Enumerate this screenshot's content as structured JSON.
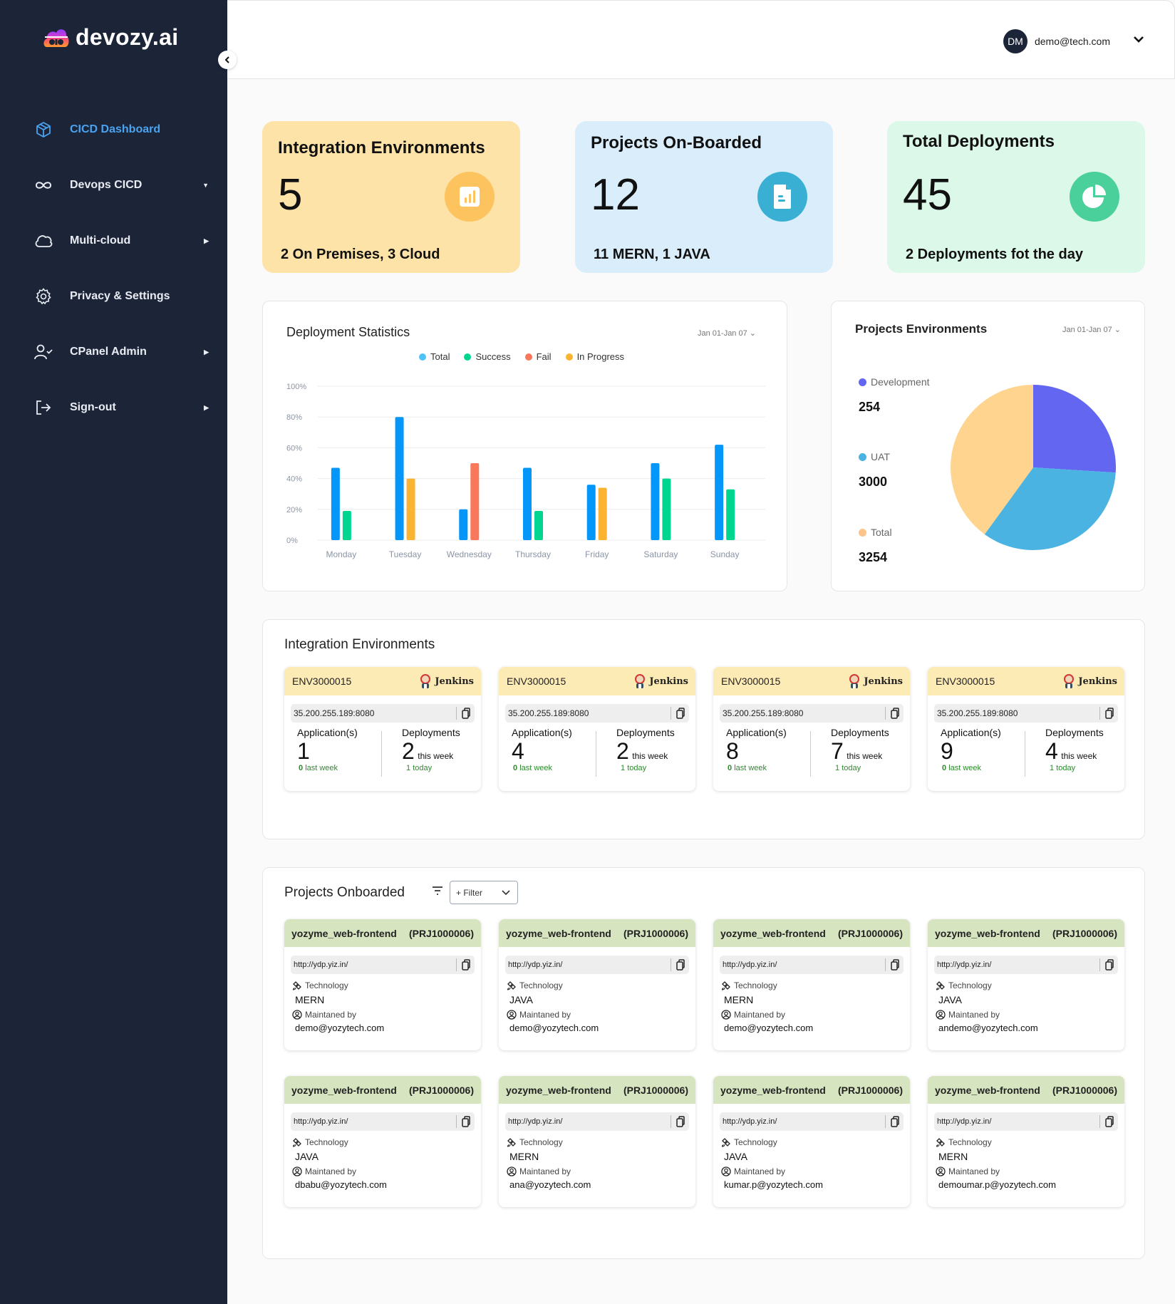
{
  "brand": {
    "name": "devozy.ai"
  },
  "sidebar": {
    "items": [
      {
        "label": "CICD Dashboard",
        "icon": "cube-icon",
        "active": true,
        "caret": ""
      },
      {
        "label": "Devops CICD",
        "icon": "infinity-icon",
        "active": false,
        "caret": "▼"
      },
      {
        "label": "Multi-cloud",
        "icon": "cloud-icon",
        "active": false,
        "caret": "▶"
      },
      {
        "label": "Privacy & Settings",
        "icon": "gear-icon",
        "active": false,
        "caret": ""
      },
      {
        "label": "CPanel Admin",
        "icon": "user-check-icon",
        "active": false,
        "caret": "▶"
      },
      {
        "label": "Sign-out",
        "icon": "sign-out-icon",
        "active": false,
        "caret": "▶"
      }
    ]
  },
  "header": {
    "user_initials": "DM",
    "user_email": "demo@tech.com"
  },
  "stats": [
    {
      "title": "Integration Environments",
      "value": "5",
      "subtitle": "2 On Premises, 3 Cloud",
      "bg": "#fee3a8",
      "icon_bg": "#fdc35e",
      "icon": "bar-chart-icon"
    },
    {
      "title": "Projects On-Boarded",
      "value": "12",
      "subtitle": "11 MERN, 1 JAVA",
      "bg": "#d9edfb",
      "icon_bg": "#3aafd4",
      "icon": "document-icon"
    },
    {
      "title": "Total Deployments",
      "value": "45",
      "subtitle": "2 Deployments fot the day",
      "bg": "#dcf8e8",
      "icon_bg": "#4ad09b",
      "icon": "pie-chart-icon"
    }
  ],
  "deployment_stats": {
    "title": "Deployment Statistics",
    "date_range": "Jan 01-Jan 07 ⌄"
  },
  "projects_environments": {
    "title": "Projects Environments",
    "date_range": "Jan 01-Jan 07 ⌄",
    "legend": [
      {
        "label": "Development",
        "value": "254",
        "color": "#6366f1"
      },
      {
        "label": "UAT",
        "value": "3000",
        "color": "#4ab3e2"
      },
      {
        "label": "Total",
        "value": "3254",
        "color": "#fcd38d"
      }
    ]
  },
  "chart_data": [
    {
      "type": "bar",
      "title": "Deployment Statistics",
      "categories": [
        "Monday",
        "Tuesday",
        "Wednesday",
        "Thursday",
        "Friday",
        "Saturday",
        "Sunday"
      ],
      "y_ticks": [
        "0%",
        "20%",
        "40%",
        "60%",
        "80%",
        "100%"
      ],
      "ylim": [
        0,
        100
      ],
      "grid": true,
      "legend_position": "top-center",
      "legend": [
        {
          "name": "Total",
          "color": "#4fc3f7"
        },
        {
          "name": "Success",
          "color": "#00d68f"
        },
        {
          "name": "Fail",
          "color": "#f9775a"
        },
        {
          "name": "In Progress",
          "color": "#fbb431"
        }
      ],
      "bars": [
        [
          {
            "series": "Total",
            "value": 47,
            "color": "#0596fa"
          },
          {
            "series": "Success",
            "value": 19,
            "color": "#00d68f"
          }
        ],
        [
          {
            "series": "Total",
            "value": 80,
            "color": "#0596fa"
          },
          {
            "series": "In Progress",
            "value": 40,
            "color": "#fbb431"
          }
        ],
        [
          {
            "series": "Total",
            "value": 20,
            "color": "#0596fa"
          },
          {
            "series": "Fail",
            "value": 50,
            "color": "#f9775a"
          }
        ],
        [
          {
            "series": "Total",
            "value": 47,
            "color": "#0596fa"
          },
          {
            "series": "Success",
            "value": 19,
            "color": "#00d68f"
          }
        ],
        [
          {
            "series": "Total",
            "value": 36,
            "color": "#0596fa"
          },
          {
            "series": "In Progress",
            "value": 34,
            "color": "#fbb431"
          }
        ],
        [
          {
            "series": "Total",
            "value": 50,
            "color": "#0596fa"
          },
          {
            "series": "Success",
            "value": 40,
            "color": "#00d68f"
          }
        ],
        [
          {
            "series": "Total",
            "value": 62,
            "color": "#0596fa"
          },
          {
            "series": "Success",
            "value": 33,
            "color": "#00d68f"
          }
        ]
      ]
    },
    {
      "type": "pie",
      "title": "Projects Environments",
      "slices": [
        {
          "label": "Development",
          "fraction": 0.26,
          "color": "#6366f1"
        },
        {
          "label": "UAT",
          "fraction": 0.34,
          "color": "#4ab3e2"
        },
        {
          "label": "Total",
          "fraction": 0.4,
          "color": "#fed48e"
        }
      ]
    }
  ],
  "integration_environments": {
    "title": "Integration Environments",
    "tool_label": "Jenkins",
    "app_label": "Application(s)",
    "dep_label": "Deployments",
    "this_week_label": "this week",
    "last_week_label": "last week",
    "today_label": "today",
    "cards": [
      {
        "id": "ENV3000015",
        "address": "35.200.255.189:8080",
        "applications": "1",
        "apps_last_week": "0",
        "deployments": "2",
        "deps_today": "1"
      },
      {
        "id": "ENV3000015",
        "address": "35.200.255.189:8080",
        "applications": "4",
        "apps_last_week": "0",
        "deployments": "2",
        "deps_today": "1"
      },
      {
        "id": "ENV3000015",
        "address": "35.200.255.189:8080",
        "applications": "8",
        "apps_last_week": "0",
        "deployments": "7",
        "deps_today": "1"
      },
      {
        "id": "ENV3000015",
        "address": "35.200.255.189:8080",
        "applications": "9",
        "apps_last_week": "0",
        "deployments": "4",
        "deps_today": "1"
      }
    ]
  },
  "projects_onboarded": {
    "title": "Projects Onboarded",
    "filter_label": "+ Filter",
    "technology_label": "Technology",
    "maintained_label": "Maintaned by",
    "cards": [
      {
        "name": "yozyme_web-frontend",
        "code": "(PRJ1000006)",
        "url": "http://ydp.yiz.in/",
        "technology": "MERN",
        "maintainer": "demo@yozytech.com"
      },
      {
        "name": "yozyme_web-frontend",
        "code": "(PRJ1000006)",
        "url": "http://ydp.yiz.in/",
        "technology": "JAVA",
        "maintainer": "demo@yozytech.com"
      },
      {
        "name": "yozyme_web-frontend",
        "code": "(PRJ1000006)",
        "url": "http://ydp.yiz.in/",
        "technology": "MERN",
        "maintainer": "demo@yozytech.com"
      },
      {
        "name": "yozyme_web-frontend",
        "code": "(PRJ1000006)",
        "url": "http://ydp.yiz.in/",
        "technology": "JAVA",
        "maintainer": "andemo@yozytech.com"
      },
      {
        "name": "yozyme_web-frontend",
        "code": "(PRJ1000006)",
        "url": "http://ydp.yiz.in/",
        "technology": "JAVA",
        "maintainer": "dbabu@yozytech.com"
      },
      {
        "name": "yozyme_web-frontend",
        "code": "(PRJ1000006)",
        "url": "http://ydp.yiz.in/",
        "technology": "MERN",
        "maintainer": "ana@yozytech.com"
      },
      {
        "name": "yozyme_web-frontend",
        "code": "(PRJ1000006)",
        "url": "http://ydp.yiz.in/",
        "technology": "JAVA",
        "maintainer": "kumar.p@yozytech.com"
      },
      {
        "name": "yozyme_web-frontend",
        "code": "(PRJ1000006)",
        "url": "http://ydp.yiz.in/",
        "technology": "MERN",
        "maintainer": "demoumar.p@yozytech.com"
      }
    ]
  }
}
